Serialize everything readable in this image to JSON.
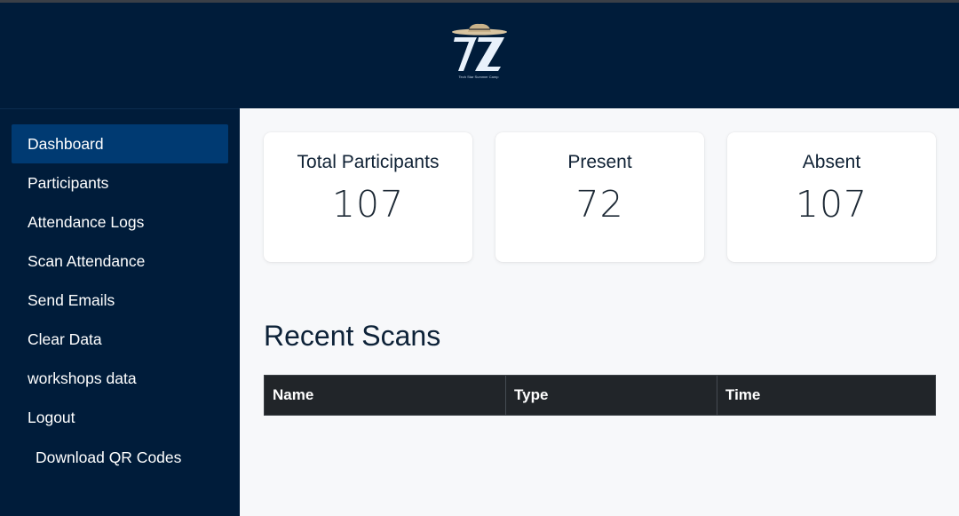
{
  "header": {
    "logo_text": "7Z",
    "logo_subtext": "Tech Star Summer Camp"
  },
  "sidebar": {
    "items": [
      {
        "label": "Dashboard",
        "active": true
      },
      {
        "label": "Participants"
      },
      {
        "label": "Attendance Logs"
      },
      {
        "label": "Scan Attendance"
      },
      {
        "label": "Send Emails"
      },
      {
        "label": "Clear Data"
      },
      {
        "label": "workshops data"
      },
      {
        "label": "Logout"
      },
      {
        "label": "Download QR Codes"
      }
    ]
  },
  "stats": [
    {
      "title": "Total Participants",
      "value": "107"
    },
    {
      "title": "Present",
      "value": "72"
    },
    {
      "title": "Absent",
      "value": "107"
    }
  ],
  "recent_scans": {
    "title": "Recent Scans",
    "columns": [
      "Name",
      "Type",
      "Time"
    ]
  },
  "colors": {
    "header_bg": "#001c3a",
    "active_item": "#003a72",
    "table_header": "#212529"
  }
}
